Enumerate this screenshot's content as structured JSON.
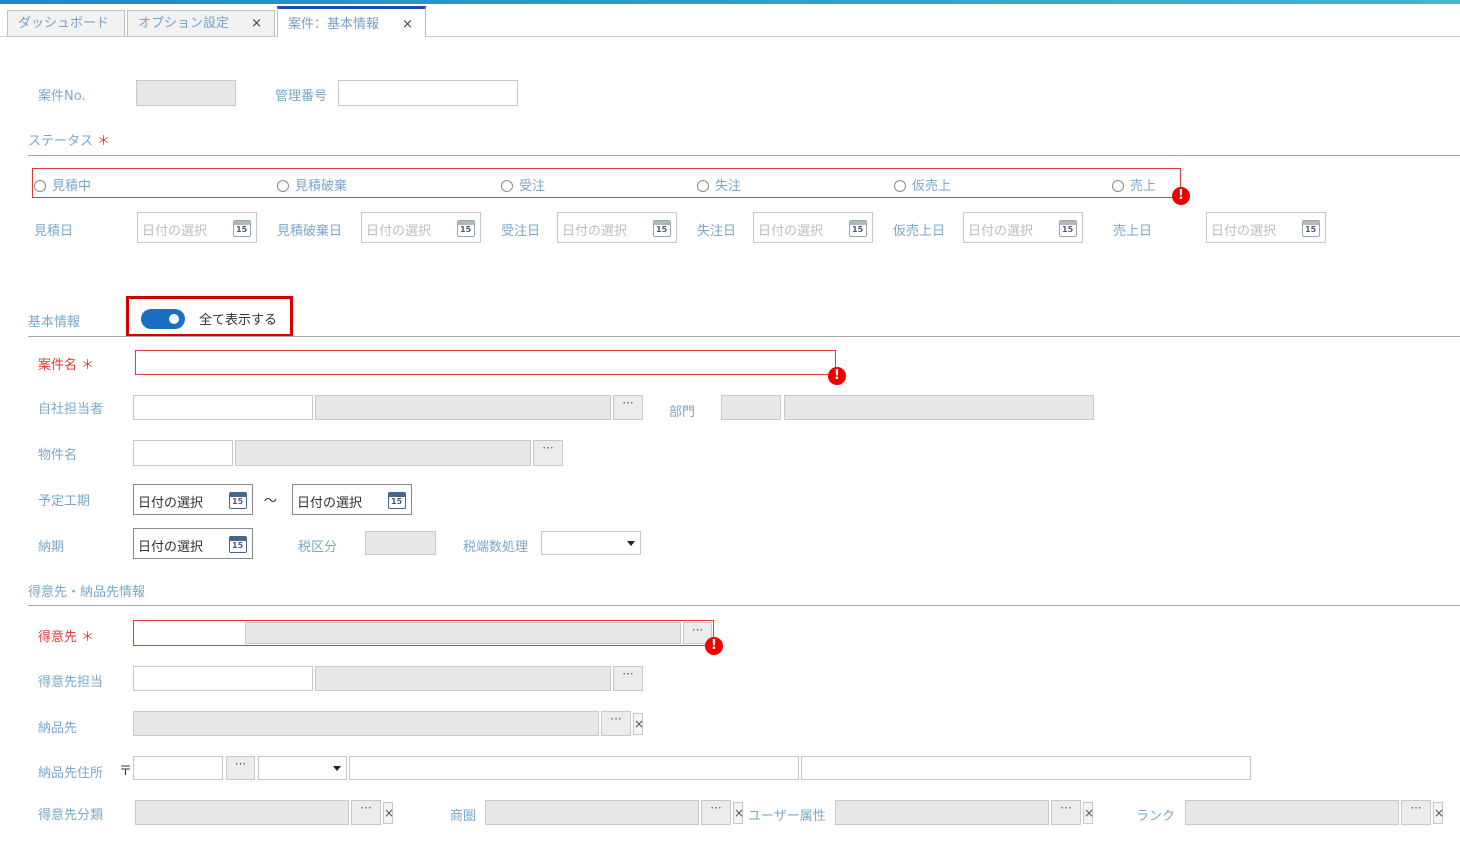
{
  "tabs": [
    {
      "label": "ダッシュボード"
    },
    {
      "label": "オプション設定",
      "close": "×"
    },
    {
      "label": "案件：基本情報",
      "close": "×"
    }
  ],
  "header": {
    "case_no_label": "案件No.",
    "mgmt_no_label": "管理番号",
    "status_label": "ステータス",
    "required_mark": "＊"
  },
  "status_options": [
    "見積中",
    "見積破棄",
    "受注",
    "失注",
    "仮売上",
    "売上"
  ],
  "error_icon": "!",
  "date_fields": [
    {
      "label": "見積日",
      "placeholder": "日付の選択"
    },
    {
      "label": "見積破棄日",
      "placeholder": "日付の選択"
    },
    {
      "label": "受注日",
      "placeholder": "日付の選択"
    },
    {
      "label": "失注日",
      "placeholder": "日付の選択"
    },
    {
      "label": "仮売上日",
      "placeholder": "日付の選択"
    },
    {
      "label": "売上日",
      "placeholder": "日付の選択"
    }
  ],
  "calendar_day": "15",
  "basic": {
    "section_title": "基本情報",
    "toggle_label": "全て表示する",
    "toggle_on": true,
    "case_name_label": "案件名",
    "staff_label": "自社担当者",
    "dept_label": "部門",
    "property_label": "物件名",
    "period_label": "予定工期",
    "period_sep": "～",
    "period_from": "日付の選択",
    "period_to": "日付の選択",
    "deadline_label": "納期",
    "deadline_value": "日付の選択",
    "tax_label": "税区分",
    "rounding_label": "税端数処理"
  },
  "customer": {
    "section_title": "得意先・納品先情報",
    "customer_label": "得意先",
    "customer_staff_label": "得意先担当",
    "delivery_label": "納品先",
    "address_label": "納品先住所",
    "postal_mark": "〒",
    "category_label": "得意先分類",
    "area_label": "商圏",
    "user_attr_label": "ユーザー属性",
    "rank_label": "ランク"
  },
  "ellipsis": "···",
  "clear": "×",
  "colors": {
    "accent": "#1a6fc0",
    "error": "#e03a3a",
    "label": "#7aa7c9"
  }
}
